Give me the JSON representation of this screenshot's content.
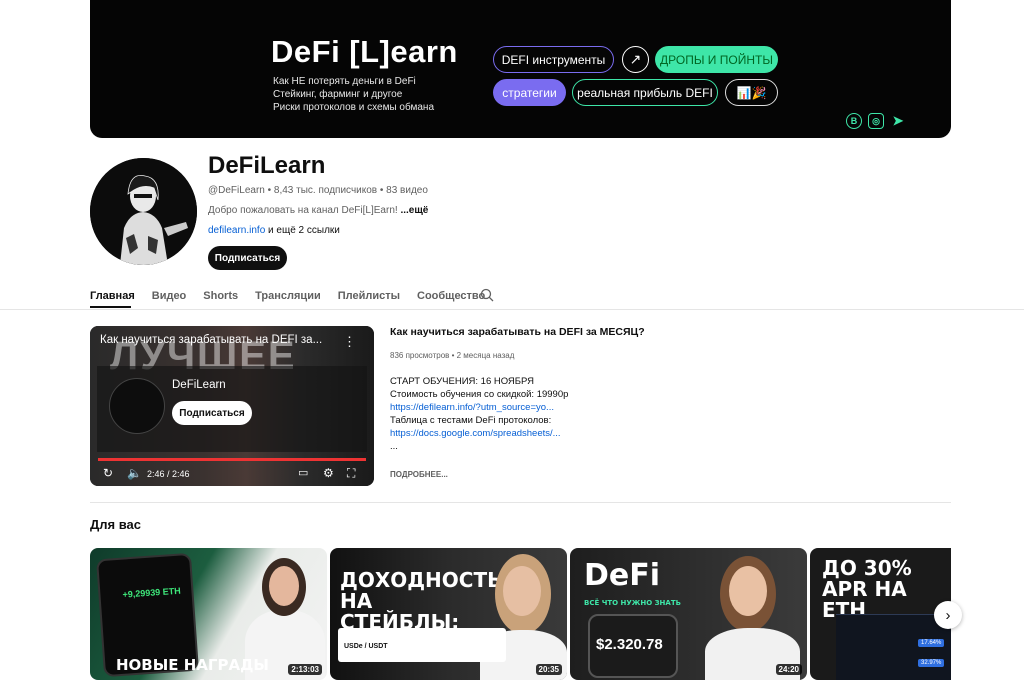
{
  "banner": {
    "logo": "DeFi [L]earn",
    "lines": [
      "Как НЕ потерять деньги в DeFi",
      "Стейкинг, фарминг и другое",
      "Риски протоколов и схемы обмана"
    ],
    "pills": {
      "tools": "DEFI инструменты",
      "drops": "ДРОПЫ И ПОЙНТЫ",
      "strategies": "стратегии",
      "profit": "реальная прибыль DEFI",
      "emoji": "📊🎉"
    },
    "social": [
      "В",
      "◎",
      "➤"
    ]
  },
  "channel": {
    "name": "DeFiLearn",
    "meta": "@DeFiLearn • 8,43 тыс. подписчиков • 83 видео",
    "desc": "Добро пожаловать на канал DeFi[L]Earn! ",
    "desc_more": "...ещё",
    "link": "defilearn.info",
    "links_more": " и ещё 2 ссылки",
    "subscribe": "Подписаться"
  },
  "tabs": [
    "Главная",
    "Видео",
    "Shorts",
    "Трансляции",
    "Плейлисты",
    "Сообщество"
  ],
  "featured": {
    "player_title": "Как научиться зарабатывать на DEFI за...",
    "bigtext": "ЛУЧШЕЕ",
    "overlay_name": "DeFiLearn",
    "overlay_subscribe": "Подписаться",
    "time": "2:46 / 2:46",
    "title": "Как научиться зарабатывать на DEFI за МЕСЯЦ?",
    "meta": "836 просмотров • 2 месяца назад",
    "desc_lines": [
      {
        "text": "СТАРТ ОБУЧЕНИЯ: 16 НОЯБРЯ",
        "link": false
      },
      {
        "text": "Стоимость обучения со скидкой: 19990р",
        "link": false
      },
      {
        "text": "https://defilearn.info/?utm_source=yo...",
        "link": true
      },
      {
        "text": " ",
        "link": false
      },
      {
        "text": "Таблица с тестами DeFi протоколов:",
        "link": false
      },
      {
        "text": "https://docs.google.com/spreadsheets/...",
        "link": true
      },
      {
        "text": "...",
        "link": false
      }
    ],
    "more": "ПОДРОБНЕЕ..."
  },
  "for_you": {
    "title": "Для вас",
    "videos": [
      {
        "thumb_text": "НОВЫЕ НАГРАДЫ",
        "sub_text": "+9,29939 ETH",
        "duration": "2:13:03"
      },
      {
        "thumb_text": "ДОХОДНОСТЬ НА СТЕЙБЛЫ:",
        "sub_text": "USDe / USDT",
        "duration": "20:35"
      },
      {
        "thumb_text": "DeFi",
        "sub_text": "ВСЁ ЧТО НУЖНО ЗНАТЬ",
        "amount": "$2.320.78",
        "duration": "24:20"
      },
      {
        "thumb_text": "ДО 30% APR НА ETH",
        "sub_text": "17.64%",
        "sub_text2": "32.97%"
      }
    ]
  },
  "colors": {
    "accent_green": "#3ee6a8",
    "accent_purple": "#7a6cf0",
    "link": "#065fd4"
  }
}
